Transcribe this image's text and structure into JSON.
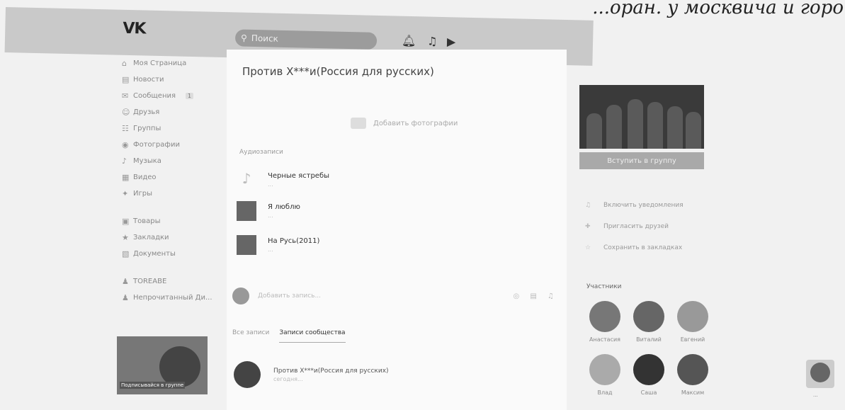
{
  "paper_text": "...оран. у москвича и горо",
  "topbar": {
    "logo": "VK",
    "search_placeholder": "Поиск",
    "icons": [
      "bell-icon",
      "music-icon",
      "play-icon"
    ]
  },
  "nav": {
    "items": [
      {
        "icon": "home-icon",
        "label": "Моя Страница"
      },
      {
        "icon": "news-icon",
        "label": "Новости"
      },
      {
        "icon": "messages-icon",
        "label": "Сообщения",
        "badge": "1"
      },
      {
        "icon": "friends-icon",
        "label": "Друзья"
      },
      {
        "icon": "groups-icon",
        "label": "Группы"
      },
      {
        "icon": "photos-icon",
        "label": "Фотографии"
      },
      {
        "icon": "music-icon",
        "label": "Музыка"
      },
      {
        "icon": "video-icon",
        "label": "Видео"
      },
      {
        "icon": "games-icon",
        "label": "Игры"
      }
    ],
    "secondary": [
      {
        "icon": "goods-icon",
        "label": "Товары"
      },
      {
        "icon": "bookmark-icon",
        "label": "Закладки"
      },
      {
        "icon": "docs-icon",
        "label": "Документы"
      }
    ],
    "apps": [
      {
        "icon": "app-icon",
        "label": "TOREABE"
      },
      {
        "icon": "app-icon",
        "label": "Непрочитанный Ди..."
      }
    ],
    "thumb_caption": "Подписывайся в группе"
  },
  "main": {
    "title": "Против Х***и(Россия для русских)",
    "add_photo": "Добавить фотографии",
    "recordings_label": "Аудиозаписи",
    "recordings": [
      {
        "name": "Черные ястребы",
        "sub": "...",
        "art": "note"
      },
      {
        "name": "Я люблю",
        "sub": "...",
        "art": "image"
      },
      {
        "name": "На Русь(2011)",
        "sub": "...",
        "art": "image"
      }
    ],
    "add_post_placeholder": "Добавить запись...",
    "post_tools": "◎ ▤ ♫",
    "tabs": [
      "Все записи",
      "Записи сообщества"
    ],
    "post": {
      "title": "Против Х***и(Россия для русских)",
      "date": "сегодня..."
    }
  },
  "right": {
    "join_label": "Вступить в группу",
    "actions": [
      {
        "icon": "bell-icon",
        "label": "Включить уведомления"
      },
      {
        "icon": "invite-icon",
        "label": "Пригласить друзей"
      },
      {
        "icon": "star-icon",
        "label": "Сохранить в закладках"
      }
    ],
    "members_title": "Участники",
    "members": [
      {
        "name": "Анастасия"
      },
      {
        "name": "Виталий"
      },
      {
        "name": "Евгений"
      },
      {
        "name": "Влад"
      },
      {
        "name": "Саша"
      },
      {
        "name": "Максим"
      }
    ]
  },
  "corner": {
    "label": "..."
  }
}
